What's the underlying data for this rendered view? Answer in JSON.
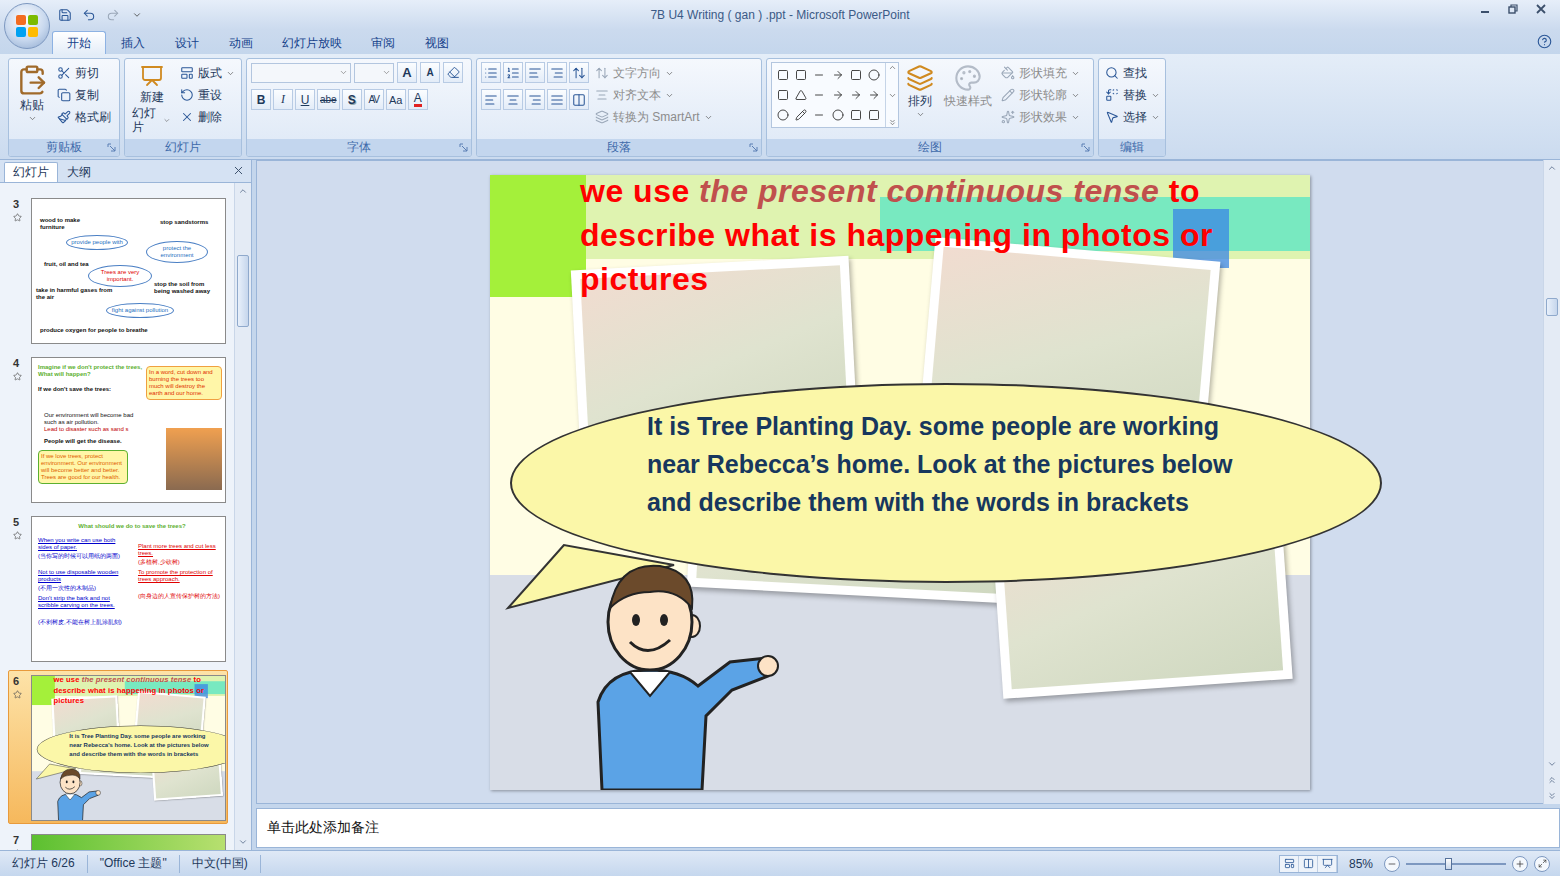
{
  "window": {
    "title": "7B U4 Writing ( gan ) .ppt - Microsoft PowerPoint"
  },
  "ribbon": {
    "tabs": [
      {
        "label": "开始",
        "selected": true
      },
      {
        "label": "插入",
        "selected": false
      },
      {
        "label": "设计",
        "selected": false
      },
      {
        "label": "动画",
        "selected": false
      },
      {
        "label": "幻灯片放映",
        "selected": false
      },
      {
        "label": "审阅",
        "selected": false
      },
      {
        "label": "视图",
        "selected": false
      }
    ],
    "clipboard": {
      "label": "剪贴板",
      "paste": "粘贴",
      "items": [
        "剪切",
        "复制",
        "格式刷"
      ]
    },
    "slides": {
      "label": "幻灯片",
      "new_slide": [
        "新建",
        "幻灯片"
      ],
      "items": [
        "版式",
        "重设",
        "删除"
      ]
    },
    "font": {
      "label": "字体",
      "size_buttons": [
        "A",
        "A"
      ],
      "format_buttons": [
        "B",
        "I",
        "U",
        "abe",
        "S",
        "AV",
        "Aa",
        "A"
      ]
    },
    "paragraph": {
      "label": "段落",
      "items": [
        {
          "label": "文字方向",
          "disabled": true
        },
        {
          "label": "对齐文本",
          "disabled": true
        },
        {
          "label": "转换为 SmartArt",
          "disabled": true
        }
      ]
    },
    "drawing": {
      "label": "绘图",
      "arrange": {
        "label": "排列",
        "disabled": false
      },
      "quick_styles": {
        "label": "快速样式",
        "disabled": true
      },
      "items": [
        {
          "label": "形状填充",
          "disabled": true
        },
        {
          "label": "形状轮廓",
          "disabled": true
        },
        {
          "label": "形状效果",
          "disabled": true
        }
      ]
    },
    "editing": {
      "label": "编辑",
      "items": [
        "查找",
        "替换",
        "选择"
      ]
    }
  },
  "slide_pane": {
    "tabs": [
      {
        "label": "幻灯片",
        "selected": true
      },
      {
        "label": "大纲",
        "selected": false
      }
    ],
    "thumbnails": [
      {
        "number": "3",
        "selected": false,
        "kind": "mindmap",
        "texts": [
          "wood to make furniture",
          "stop sandstorms",
          "provide people with",
          "protect the environment",
          "fruit, oil and tea",
          "Trees are very important.",
          "take in harmful gases from the air",
          "stop the soil from being washed away",
          "fight against pollution",
          "produce oxygen for people to breathe"
        ]
      },
      {
        "number": "4",
        "selected": false,
        "kind": "effects",
        "texts": [
          "Imagine if we don't protect the trees, What will happen?",
          "If we don't  save the trees:",
          "In a word, cut down and burning the trees too much will destroy the earth and our home.",
          "Our environment will become bad such  as air pollution.",
          "Lead to disaster such as sand s",
          "People will get the disease.",
          "If we love trees, protect environment. Our environment will become better and better. Trees are good for our health."
        ]
      },
      {
        "number": "5",
        "selected": false,
        "kind": "actions",
        "texts": [
          "What should we do to save the trees?",
          "When you write can use both sides of paper.",
          "(当你写的时候可以用纸的两面)",
          "Not to use disposable wooden products",
          "(不用一次性的木制品)",
          "Don't strip the bark and not scribble carving on the trees.",
          "(不剥树皮,不能在树上乱涂乱刻)",
          "Plant more trees and cut less trees.",
          "(多植树,少砍树)",
          "To promote the protection of trees approach.",
          "(向身边的人宣传保护树的方法)"
        ]
      },
      {
        "number": "6",
        "selected": true,
        "kind": "current",
        "texts": []
      },
      {
        "number": "7",
        "selected": false,
        "kind": "partial",
        "texts": []
      }
    ]
  },
  "slide": {
    "title": [
      {
        "text": "we use ",
        "italic": false,
        "color": "#ff0000"
      },
      {
        "text": "the present continuous tense",
        "italic": true,
        "color": "#c0504d"
      },
      {
        "text": " to describe what is happening in photos or pictures",
        "italic": false,
        "color": "#ff0000"
      }
    ],
    "bubble": "It is Tree Planting Day. some people are working near Rebecca’s home. Look at the pictures below and describe them with the words in brackets"
  },
  "notes": {
    "placeholder": "单击此处添加备注"
  },
  "status_bar": {
    "items": [
      "幻灯片 6/26",
      "\"Office 主题\"",
      "中文(中国)"
    ],
    "zoom": "85%",
    "zoom_level": 0.42
  }
}
